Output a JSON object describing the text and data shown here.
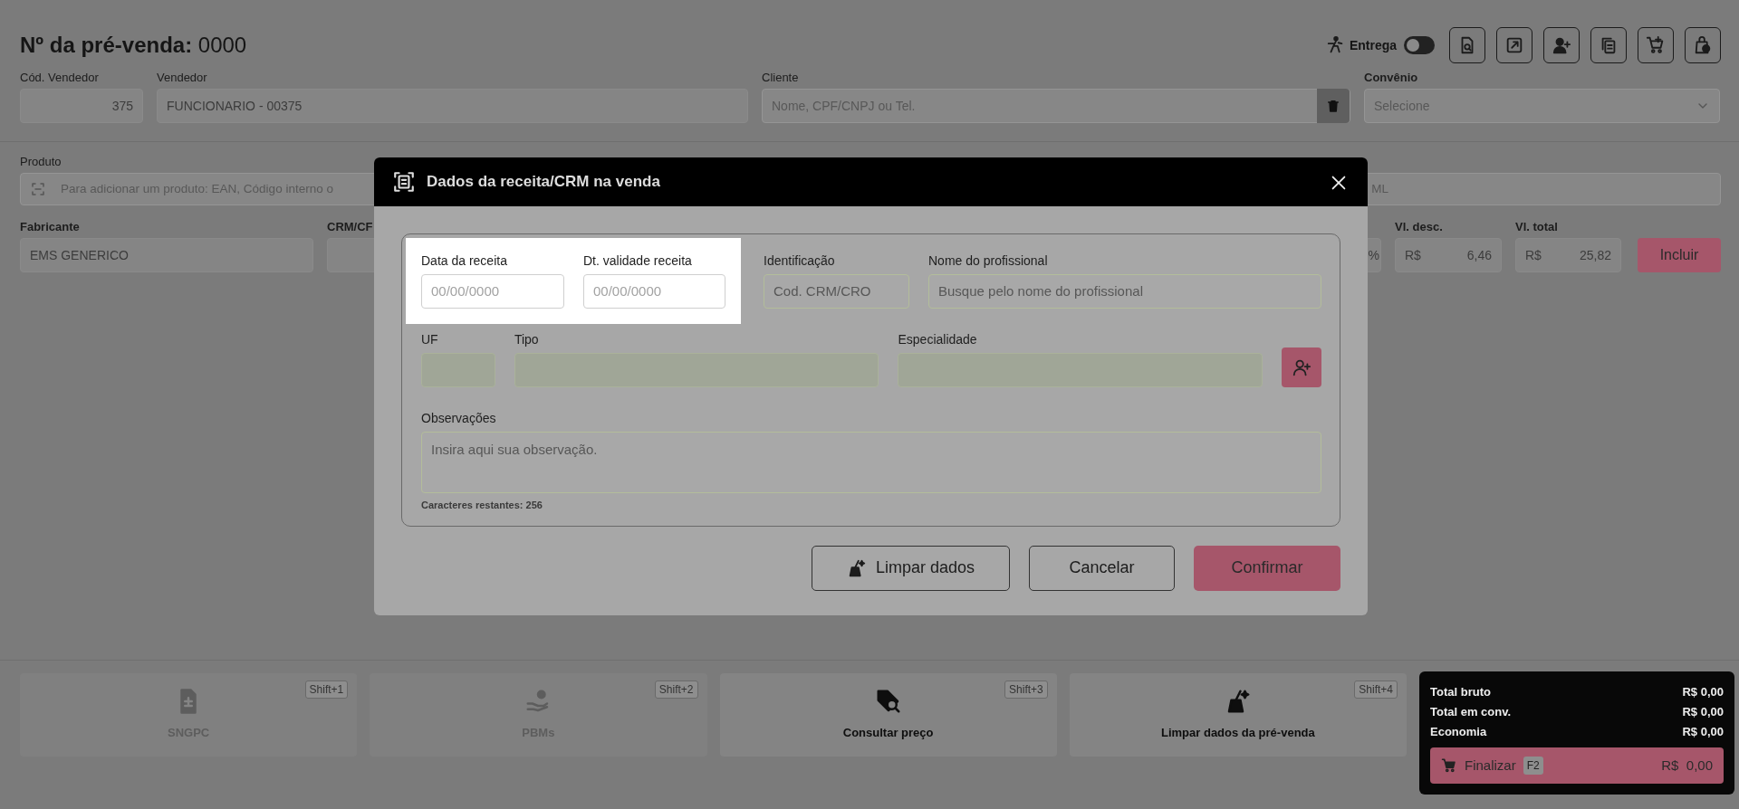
{
  "header": {
    "title_label": "Nº da pré-venda:",
    "title_number": "0000",
    "delivery": {
      "label": "Entrega",
      "on": false
    }
  },
  "top_fields": [
    {
      "kind": "number",
      "label": "Cód. Vendedor",
      "value": "375"
    },
    {
      "kind": "text",
      "label": "Vendedor",
      "value": "FUNCIONARIO - 00375"
    },
    {
      "kind": "search",
      "label": "Cliente",
      "placeholder": "Nome, CPF/CNPJ ou Tel."
    },
    {
      "kind": "select",
      "label": "Convênio",
      "placeholder": "Selecione"
    }
  ],
  "product": {
    "label": "Produto",
    "placeholder_start": "Para adicionar um produto: EAN, Código interno o",
    "placeholder_end": "ML"
  },
  "item_row": {
    "manufacturer": {
      "label": "Fabricante",
      "value": "EMS GENERICO"
    },
    "crm": {
      "label": "CRM/CF",
      "suffix": "%"
    },
    "discount": {
      "label": "Vl. desc.",
      "currency": "R$",
      "value": "6,46"
    },
    "total": {
      "label": "Vl. total",
      "currency": "R$",
      "value": "25,82"
    },
    "button": "Incluir"
  },
  "modal": {
    "title": "Dados da receita/CRM na venda",
    "date_fields": [
      {
        "label": "Data da receita",
        "placeholder": "00/00/0000"
      },
      {
        "label": "Dt. validade receita",
        "placeholder": "00/00/0000"
      }
    ],
    "id_field": {
      "label": "Identificação",
      "placeholder": "Cod. CRM/CRO"
    },
    "name_field": {
      "label": "Nome do profissional",
      "placeholder": "Busque pelo nome do profissional"
    },
    "row2": [
      {
        "label": "UF"
      },
      {
        "label": "Tipo"
      },
      {
        "label": "Especialidade"
      }
    ],
    "notes": {
      "label": "Observações",
      "placeholder": "Insira aqui sua observação.",
      "counter": "Caracteres restantes: 256"
    },
    "buttons": [
      {
        "kind": "clear",
        "label": "Limpar dados"
      },
      {
        "kind": "cancel",
        "label": "Cancelar"
      },
      {
        "kind": "confirm",
        "label": "Confirmar"
      }
    ]
  },
  "shortcuts": [
    {
      "label": "SNGPC",
      "key": "Shift+1",
      "disabled": true
    },
    {
      "label": "PBMs",
      "key": "Shift+2",
      "disabled": true
    },
    {
      "label": "Consultar preço",
      "key": "Shift+3",
      "disabled": false
    },
    {
      "label": "Limpar dados da pré-venda",
      "key": "Shift+4",
      "disabled": false
    }
  ],
  "totals": {
    "rows": [
      {
        "label": "Total bruto",
        "value": "R$ 0,00"
      },
      {
        "label": "Total em conv.",
        "value": "R$ 0,00"
      },
      {
        "label": "Economia",
        "value": "R$ 0,00"
      }
    ],
    "finalize": {
      "label": "Finalizar",
      "key": "F2",
      "amount": "R$  0,00"
    }
  }
}
